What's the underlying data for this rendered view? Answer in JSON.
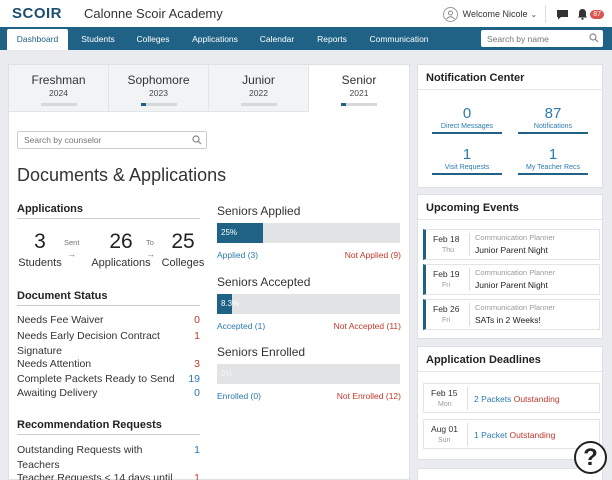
{
  "topbar": {
    "logo": "SCOIR",
    "school": "Calonne Scoir Academy",
    "welcome": "Welcome Nicole",
    "notification_count": "87"
  },
  "nav": {
    "tabs": [
      {
        "label": "Dashboard",
        "active": true
      },
      {
        "label": "Students"
      },
      {
        "label": "Colleges"
      },
      {
        "label": "Applications"
      },
      {
        "label": "Calendar"
      },
      {
        "label": "Reports"
      },
      {
        "label": "Communication"
      }
    ],
    "search_placeholder": "Search by name"
  },
  "years": [
    {
      "name": "Freshman",
      "year": "2024",
      "progress": 0
    },
    {
      "name": "Sophomore",
      "year": "2023",
      "progress": 0.15
    },
    {
      "name": "Junior",
      "year": "2022",
      "progress": 0
    },
    {
      "name": "Senior",
      "year": "2021",
      "progress": 0.15,
      "active": true
    }
  ],
  "counselor_placeholder": "Search by counselor",
  "documents_title": "Documents & Applications",
  "applications": {
    "title": "Applications",
    "students_num": "3",
    "students_label": "Students",
    "sent_label": "Sent",
    "applications_num": "26",
    "applications_label": "Applications",
    "to_label": "To",
    "colleges_num": "25",
    "colleges_label": "Colleges"
  },
  "document_status": {
    "title": "Document Status",
    "rows": [
      {
        "label": "Needs Fee Waiver",
        "value": "0",
        "color": "red"
      },
      {
        "label": "Needs Early Decision Contract Signature",
        "value": "1",
        "color": "red"
      },
      {
        "label": "Needs Attention",
        "value": "3",
        "color": "red"
      },
      {
        "label": "Complete Packets Ready to Send",
        "value": "19",
        "color": "blue"
      },
      {
        "label": "Awaiting Delivery",
        "value": "0",
        "color": "blue"
      }
    ]
  },
  "recommendations": {
    "title": "Recommendation Requests",
    "rows": [
      {
        "label": "Outstanding Requests with Teachers",
        "value": "1"
      },
      {
        "label": "Teacher Requests < 14 days until",
        "value": "1"
      }
    ]
  },
  "seniors": [
    {
      "title": "Seniors Applied",
      "percent": 25,
      "percent_label": "25%",
      "left": "Applied (3)",
      "right": "Not Applied (9)"
    },
    {
      "title": "Seniors Accepted",
      "percent": 8.3,
      "percent_label": "8.3%",
      "left": "Accepted (1)",
      "right": "Not Accepted (11)"
    },
    {
      "title": "Seniors Enrolled",
      "percent": 0,
      "percent_label": "0%",
      "left": "Enrolled (0)",
      "right": "Not Enrolled (12)"
    }
  ],
  "notification_center": {
    "title": "Notification Center",
    "items": [
      {
        "num": "0",
        "label": "Direct Messages"
      },
      {
        "num": "87",
        "label": "Notifications"
      },
      {
        "num": "1",
        "label": "Visit Requests"
      },
      {
        "num": "1",
        "label": "My Teacher Recs"
      }
    ]
  },
  "upcoming_events": {
    "title": "Upcoming Events",
    "items": [
      {
        "date": "Feb 18",
        "day": "Thu",
        "category": "Communication Planner",
        "name": "Junior Parent Night"
      },
      {
        "date": "Feb 19",
        "day": "Fri",
        "category": "Communication Planner",
        "name": "Junior Parent Night"
      },
      {
        "date": "Feb 26",
        "day": "Fri",
        "category": "Communication Planner",
        "name": "SATs in 2 Weeks!"
      }
    ]
  },
  "application_deadlines": {
    "title": "Application Deadlines",
    "items": [
      {
        "date": "Feb 15",
        "day": "Mon",
        "count": "2 Packets",
        "status": "Outstanding"
      },
      {
        "date": "Aug 01",
        "day": "Sun",
        "count": "1 Packet",
        "status": "Outstanding"
      }
    ]
  },
  "help_glyph": "?"
}
